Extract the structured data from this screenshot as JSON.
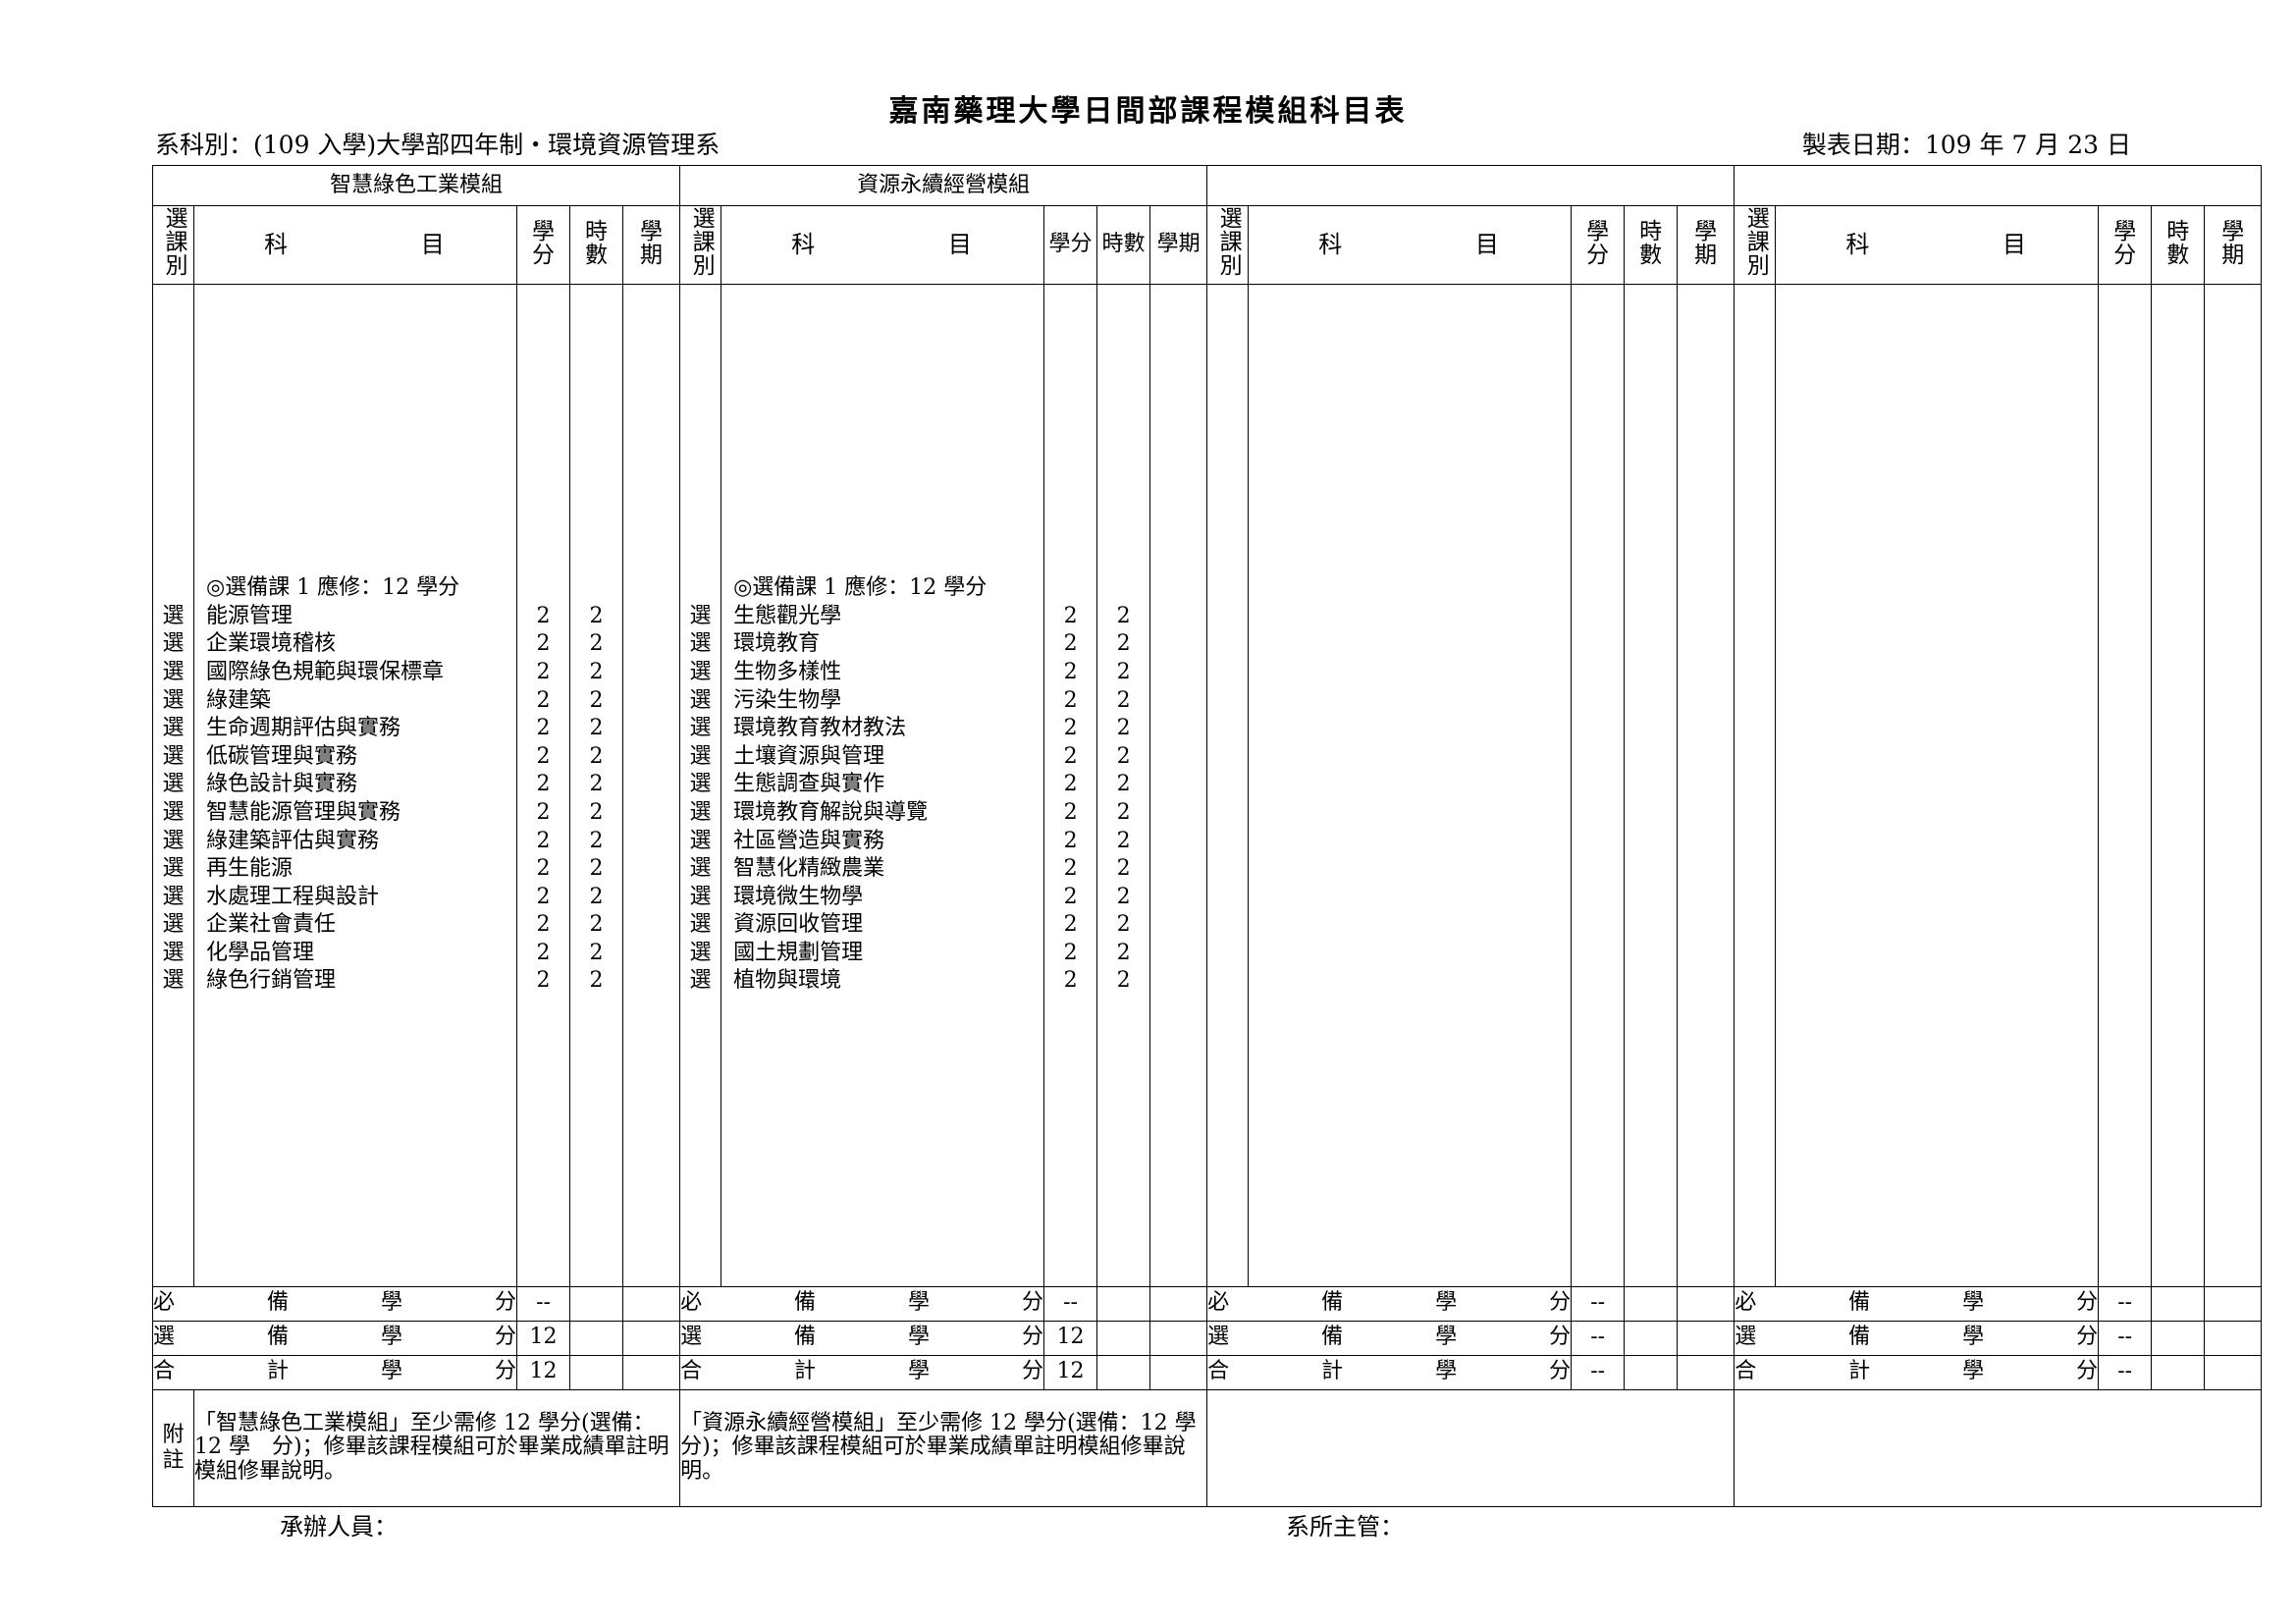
{
  "document": {
    "title": "嘉南藥理大學日間部課程模組科目表",
    "department_label": "系科別：",
    "department_value": "(109 入學)大學部四年制‧環境資源管理系",
    "date_line": "製表日期：109 年 7 月 23 日"
  },
  "column_headers": {
    "kind": "選課別",
    "subject": "科　目",
    "credits": "學分",
    "hours": "時數",
    "semester": "學期"
  },
  "summary_labels": {
    "required": [
      "必",
      "備",
      "學",
      "分"
    ],
    "elective": [
      "選",
      "備",
      "學",
      "分"
    ],
    "total": [
      "合",
      "計",
      "學",
      "分"
    ]
  },
  "note_label": "附註",
  "footer": {
    "handler": "承辦人員：",
    "supervisor": "系所主管："
  },
  "modules": [
    {
      "name": "智慧綠色工業模組",
      "group_note": "◎選備課 1 應修：12 學分",
      "header_orientation": "stacked",
      "courses": [
        {
          "kind": "選",
          "name": "能源管理",
          "credits": "2",
          "hours": "2",
          "semester": ""
        },
        {
          "kind": "選",
          "name": "企業環境稽核",
          "credits": "2",
          "hours": "2",
          "semester": ""
        },
        {
          "kind": "選",
          "name": "國際綠色規範與環保標章",
          "credits": "2",
          "hours": "2",
          "semester": ""
        },
        {
          "kind": "選",
          "name": "綠建築",
          "credits": "2",
          "hours": "2",
          "semester": ""
        },
        {
          "kind": "選",
          "name": "生命週期評估與實務",
          "credits": "2",
          "hours": "2",
          "semester": ""
        },
        {
          "kind": "選",
          "name": "低碳管理與實務",
          "credits": "2",
          "hours": "2",
          "semester": ""
        },
        {
          "kind": "選",
          "name": "綠色設計與實務",
          "credits": "2",
          "hours": "2",
          "semester": ""
        },
        {
          "kind": "選",
          "name": "智慧能源管理與實務",
          "credits": "2",
          "hours": "2",
          "semester": ""
        },
        {
          "kind": "選",
          "name": "綠建築評估與實務",
          "credits": "2",
          "hours": "2",
          "semester": ""
        },
        {
          "kind": "選",
          "name": "再生能源",
          "credits": "2",
          "hours": "2",
          "semester": ""
        },
        {
          "kind": "選",
          "name": "水處理工程與設計",
          "credits": "2",
          "hours": "2",
          "semester": ""
        },
        {
          "kind": "選",
          "name": "企業社會責任",
          "credits": "2",
          "hours": "2",
          "semester": ""
        },
        {
          "kind": "選",
          "name": "化學品管理",
          "credits": "2",
          "hours": "2",
          "semester": ""
        },
        {
          "kind": "選",
          "name": "綠色行銷管理",
          "credits": "2",
          "hours": "2",
          "semester": ""
        }
      ],
      "summary": {
        "required": "--",
        "elective": "12",
        "total": "12"
      },
      "note": "「智慧綠色工業模組」至少需修 12 學分(選備：12 學　分)；修畢該課程模組可於畢業成績單註明模組修畢說明。"
    },
    {
      "name": "資源永續經營模組",
      "group_note": "◎選備課 1 應修：12 學分",
      "header_orientation": "inline",
      "courses": [
        {
          "kind": "選",
          "name": "生態觀光學",
          "credits": "2",
          "hours": "2",
          "semester": ""
        },
        {
          "kind": "選",
          "name": "環境教育",
          "credits": "2",
          "hours": "2",
          "semester": ""
        },
        {
          "kind": "選",
          "name": "生物多樣性",
          "credits": "2",
          "hours": "2",
          "semester": ""
        },
        {
          "kind": "選",
          "name": "污染生物學",
          "credits": "2",
          "hours": "2",
          "semester": ""
        },
        {
          "kind": "選",
          "name": "環境教育教材教法",
          "credits": "2",
          "hours": "2",
          "semester": ""
        },
        {
          "kind": "選",
          "name": "土壤資源與管理",
          "credits": "2",
          "hours": "2",
          "semester": ""
        },
        {
          "kind": "選",
          "name": "生態調查與實作",
          "credits": "2",
          "hours": "2",
          "semester": ""
        },
        {
          "kind": "選",
          "name": "環境教育解說與導覽",
          "credits": "2",
          "hours": "2",
          "semester": ""
        },
        {
          "kind": "選",
          "name": "社區營造與實務",
          "credits": "2",
          "hours": "2",
          "semester": ""
        },
        {
          "kind": "選",
          "name": "智慧化精緻農業",
          "credits": "2",
          "hours": "2",
          "semester": ""
        },
        {
          "kind": "選",
          "name": "環境微生物學",
          "credits": "2",
          "hours": "2",
          "semester": ""
        },
        {
          "kind": "選",
          "name": "資源回收管理",
          "credits": "2",
          "hours": "2",
          "semester": ""
        },
        {
          "kind": "選",
          "name": "國土規劃管理",
          "credits": "2",
          "hours": "2",
          "semester": ""
        },
        {
          "kind": "選",
          "name": "植物與環境",
          "credits": "2",
          "hours": "2",
          "semester": ""
        }
      ],
      "summary": {
        "required": "--",
        "elective": "12",
        "total": "12"
      },
      "note": "「資源永續經營模組」至少需修 12 學分(選備：12 學分)；修畢該課程模組可於畢業成績單註明模組修畢說明。"
    },
    {
      "name": "",
      "group_note": "",
      "header_orientation": "stacked",
      "courses": [],
      "summary": {
        "required": "--",
        "elective": "--",
        "total": "--"
      },
      "note": ""
    },
    {
      "name": "",
      "group_note": "",
      "header_orientation": "stacked",
      "courses": [],
      "summary": {
        "required": "--",
        "elective": "--",
        "total": "--"
      },
      "note": ""
    }
  ]
}
